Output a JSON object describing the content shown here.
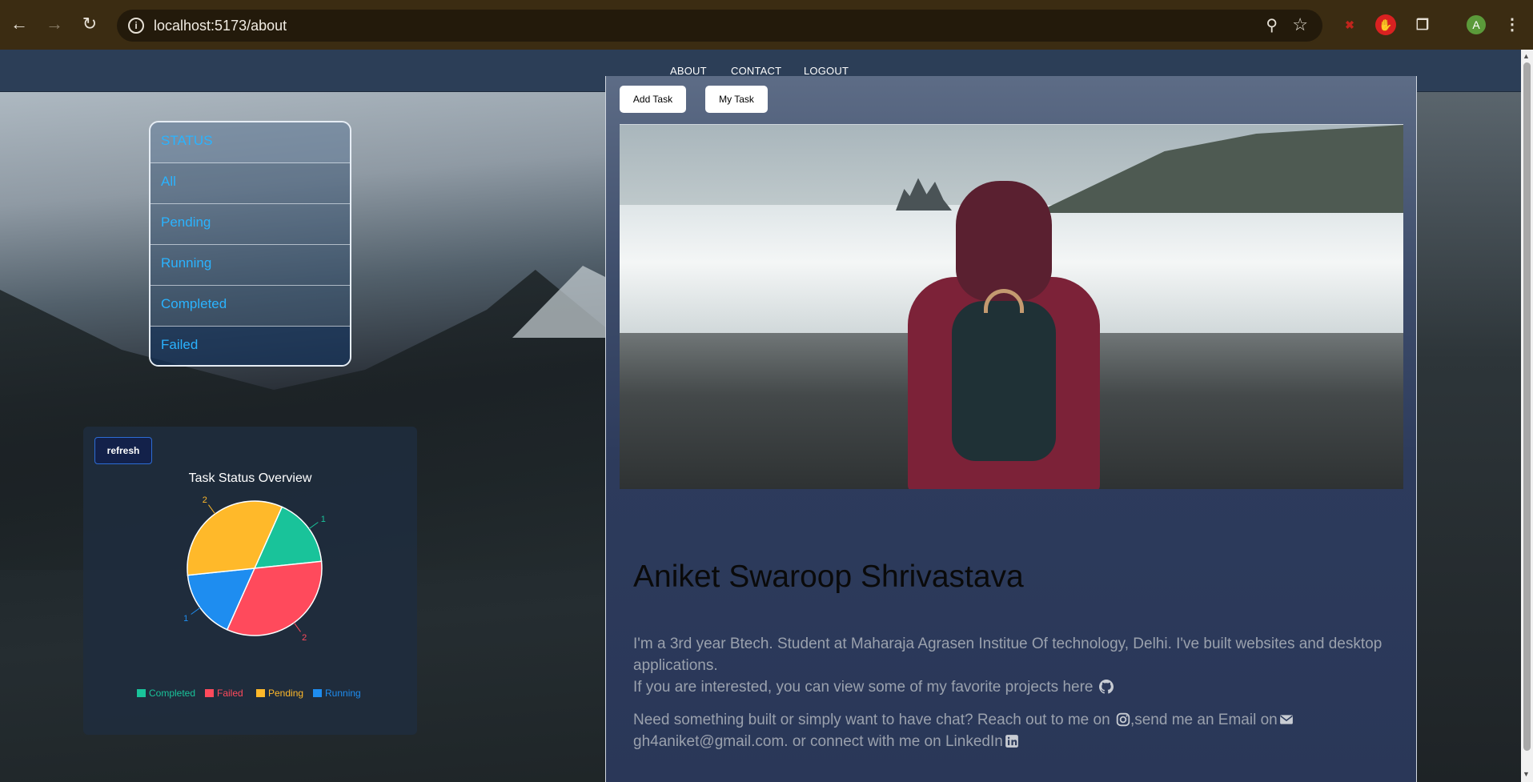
{
  "browser": {
    "url": "localhost:5173/about",
    "avatar_letter": "A"
  },
  "nav": {
    "items": [
      "ABOUT",
      "CONTACT",
      "LOGOUT"
    ]
  },
  "status_panel": {
    "items": [
      "STATUS",
      "All",
      "Pending",
      "Running",
      "Completed",
      "Failed"
    ]
  },
  "chart_card": {
    "refresh_label": "refresh"
  },
  "chart_data": {
    "type": "pie",
    "title": "Task Status Overview",
    "categories": [
      "Completed",
      "Failed",
      "Pending",
      "Running"
    ],
    "values": [
      1,
      2,
      2,
      1
    ],
    "colors": [
      "#19c39a",
      "#ff4a5c",
      "#ffb92a",
      "#1e8df0"
    ],
    "legend": "bottom"
  },
  "main": {
    "add_task_label": "Add Task",
    "my_task_label": "My Task",
    "name": "Aniket Swaroop Shrivastava",
    "bio_line1": "I'm a 3rd year Btech. Student at Maharaja Agrasen Institue Of technology, Delhi. I've built websites and desktop applications.",
    "bio_line2": "If you are interested, you can view some of my favorite projects here",
    "contact_part1": "Need something built or simply want to have chat? Reach out to me on",
    "contact_part2": ",send me an Email on",
    "contact_part3": "gh4aniket@gmail.com. or connect with me on LinkedIn"
  },
  "colors": {
    "nav_bg": "#2c3e57",
    "status_text": "#2ab3ff",
    "accent_button": "#13214a"
  }
}
